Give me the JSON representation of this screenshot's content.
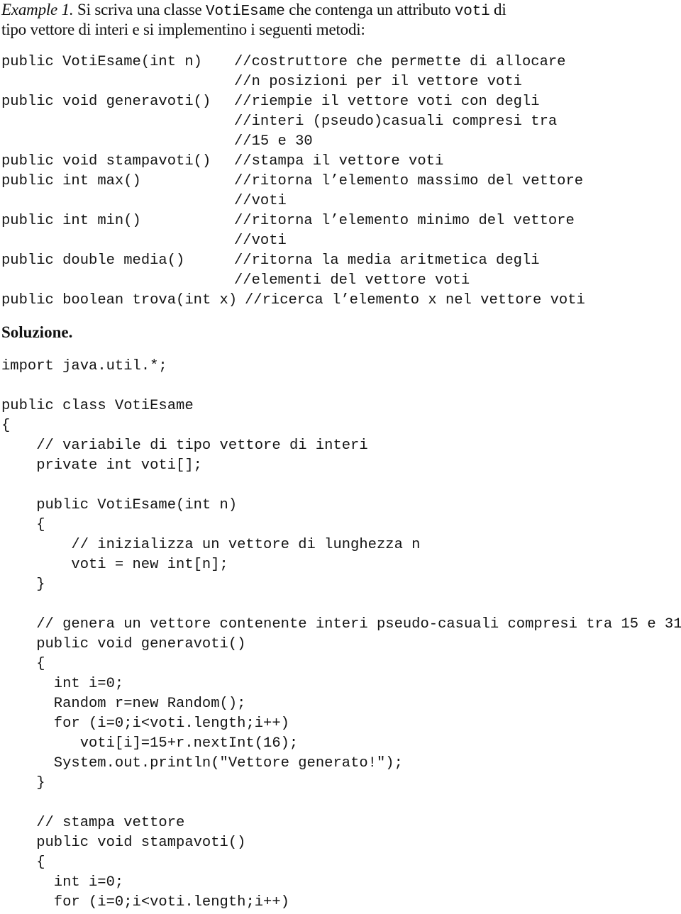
{
  "intro": {
    "label": "Example 1.",
    "line1_a": " Si scriva una classe ",
    "class_name": "VotiEsame",
    "line1_b": " che contenga un attributo ",
    "attr_name": "voti",
    "line1_c": " di",
    "line2": "tipo vettore di interi e si implementino i seguenti metodi:"
  },
  "methods_table": [
    {
      "signature": "public VotiEsame(int n)",
      "comment": [
        "//costruttore che permette di allocare",
        "//n posizioni per il vettore voti"
      ]
    },
    {
      "signature": "public void generavoti()",
      "comment": [
        "//riempie il vettore voti con degli",
        "//interi (pseudo)casuali compresi tra",
        "//15 e 30"
      ]
    },
    {
      "signature": "public void stampavoti()",
      "comment": [
        "//stampa il vettore voti"
      ]
    },
    {
      "signature": "public int max()",
      "comment": [
        "//ritorna l’elemento massimo del vettore",
        "//voti"
      ]
    },
    {
      "signature": "public int min()",
      "comment": [
        "//ritorna l’elemento minimo del vettore",
        "//voti"
      ]
    },
    {
      "signature": "public double media()",
      "comment": [
        "//ritorna la media aritmetica degli",
        "//elementi del vettore voti"
      ]
    },
    {
      "signature": "public boolean trova(int x)",
      "comment": [
        "//ricerca l’elemento x nel vettore voti"
      ]
    }
  ],
  "solution_heading": "Soluzione.",
  "code_lines": [
    {
      "text": "import java.util.*;",
      "indent": 0
    },
    {
      "text": "",
      "indent": 0
    },
    {
      "text": "public class VotiEsame",
      "indent": 0
    },
    {
      "text": "{",
      "indent": 0
    },
    {
      "text": "// variabile di tipo vettore di interi",
      "indent": 4
    },
    {
      "text": "private int voti[];",
      "indent": 4
    },
    {
      "text": "",
      "indent": 0
    },
    {
      "text": "public VotiEsame(int n)",
      "indent": 4
    },
    {
      "text": "{",
      "indent": 4
    },
    {
      "text": "// inizializza un vettore di lunghezza n",
      "indent": 8
    },
    {
      "text": "voti = new int[n];",
      "indent": 8
    },
    {
      "text": "}",
      "indent": 4
    },
    {
      "text": "",
      "indent": 0
    },
    {
      "text": "// genera un vettore contenente interi pseudo-casuali compresi tra 15 e 31",
      "indent": 4
    },
    {
      "text": "public void generavoti()",
      "indent": 4
    },
    {
      "text": "{",
      "indent": 4
    },
    {
      "text": "int i=0;",
      "indent": 6
    },
    {
      "text": "Random r=new Random();",
      "indent": 6
    },
    {
      "text": "for (i=0;i<voti.length;i++)",
      "indent": 6
    },
    {
      "text": "voti[i]=15+r.nextInt(16);",
      "indent": 9
    },
    {
      "text": "System.out.println(\"Vettore generato!\");",
      "indent": 6
    },
    {
      "text": "}",
      "indent": 4
    },
    {
      "text": "",
      "indent": 0
    },
    {
      "text": "// stampa vettore",
      "indent": 4
    },
    {
      "text": "public void stampavoti()",
      "indent": 4
    },
    {
      "text": "{",
      "indent": 4
    },
    {
      "text": "int i=0;",
      "indent": 6
    },
    {
      "text": "for (i=0;i<voti.length;i++)",
      "indent": 6
    }
  ]
}
